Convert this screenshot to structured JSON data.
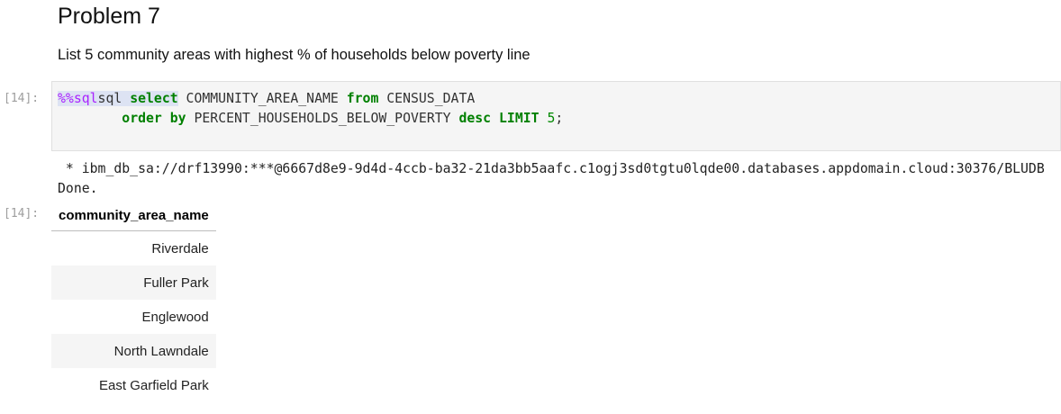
{
  "heading": "Problem 7",
  "description": "List 5 community areas with highest % of households below poverty line",
  "cell_prompt": "[14]:",
  "output_prompt": "[14]:",
  "code": {
    "magic": "%%sql",
    "kw_select": "select",
    "t1": " COMMUNITY_AREA_NAME ",
    "kw_from": "from",
    "t2": " CENSUS_DATA",
    "indent": "        ",
    "kw_order": "order by",
    "t3": " PERCENT_HOUSEHOLDS_BELOW_POVERTY ",
    "kw_desc": "desc",
    "kw_limit": "LIMIT",
    "num": "5",
    "end": ";"
  },
  "output_lines": [
    " * ibm_db_sa://drf13990:***@6667d8e9-9d4d-4ccb-ba32-21da3bb5aafc.c1ogj3sd0tgtu0lqde00.databases.appdomain.cloud:30376/BLUDB",
    "Done."
  ],
  "table": {
    "header": "community_area_name",
    "rows": [
      "Riverdale",
      "Fuller Park",
      "Englewood",
      "North Lawndale",
      "East Garfield Park"
    ]
  }
}
